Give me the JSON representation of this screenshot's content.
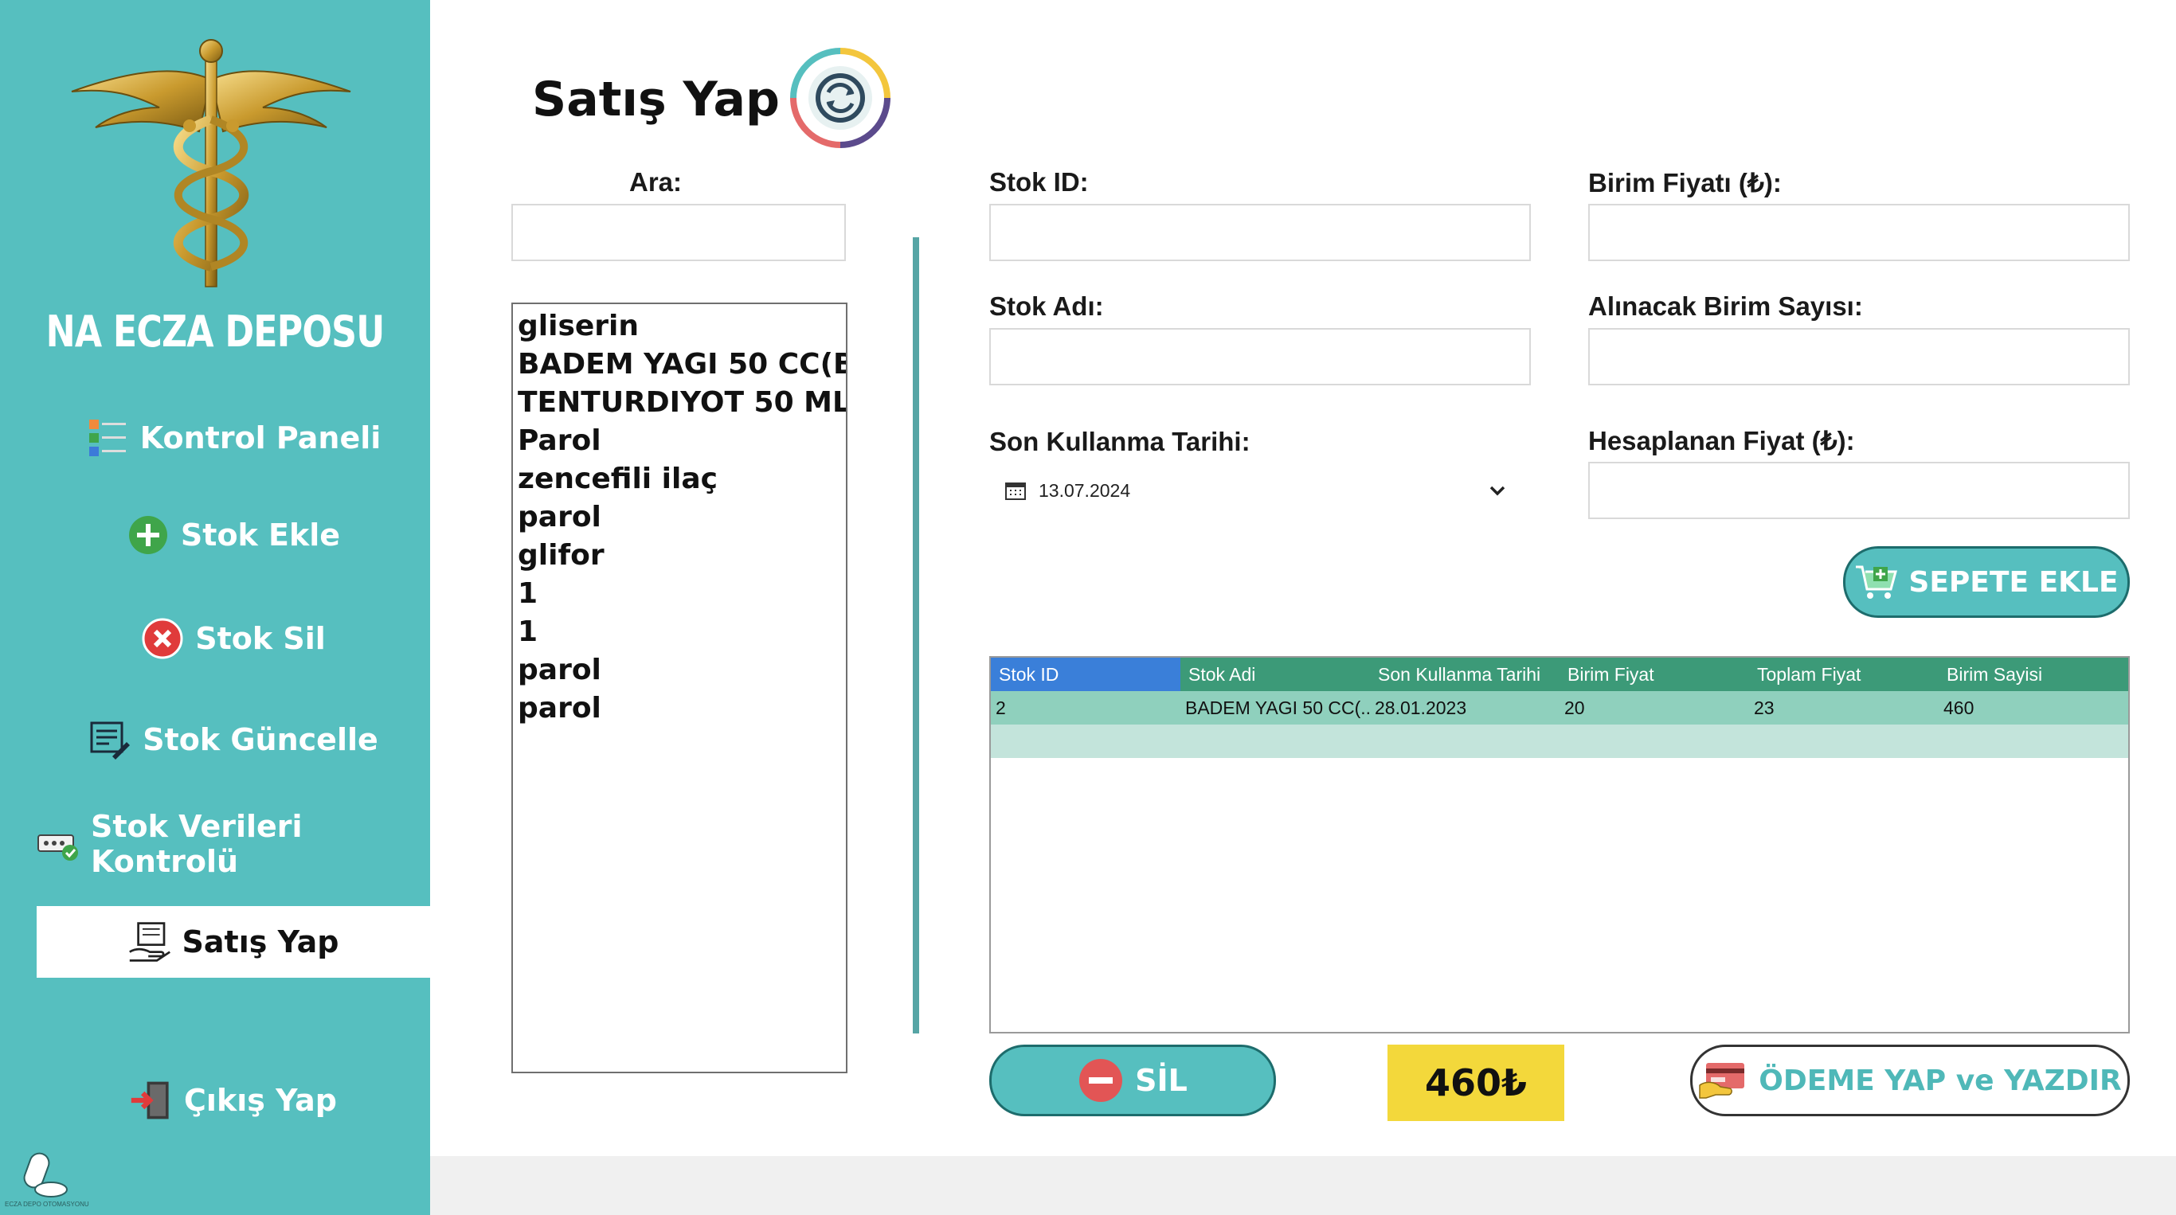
{
  "sidebar": {
    "brand": "NA ECZA DEPOSU",
    "items": [
      {
        "label": "Kontrol Paneli"
      },
      {
        "label": "Stok Ekle"
      },
      {
        "label": "Stok Sil"
      },
      {
        "label": "Stok Güncelle"
      },
      {
        "label": "Stok Verileri Kontrolü"
      },
      {
        "label": "Satış Yap"
      },
      {
        "label": "Çıkış Yap"
      }
    ],
    "active_item": "Satış Yap",
    "footer_text": "ECZA DEPO OTOMASYONU"
  },
  "page": {
    "title": "Satış Yap"
  },
  "search": {
    "label": "Ara:",
    "value": ""
  },
  "product_list": [
    "gliserin",
    "BADEM YAGI 50 CC(B",
    "TENTURDIYOT 50 ML",
    "Parol",
    "zencefili ilaç",
    "parol",
    "glifor",
    "1",
    "1",
    "parol",
    "parol"
  ],
  "form": {
    "stock_id_label": "Stok ID:",
    "stock_id_value": "",
    "unit_price_label": "Birim Fiyatı (₺):",
    "unit_price_value": "",
    "stock_name_label": "Stok Adı:",
    "stock_name_value": "",
    "unit_count_label": "Alınacak Birim Sayısı:",
    "unit_count_value": "",
    "expiry_label": "Son Kullanma Tarihi:",
    "expiry_value": "13.07.2024",
    "calc_price_label": "Hesaplanan Fiyat (₺):",
    "calc_price_value": ""
  },
  "buttons": {
    "add_to_cart": "SEPETE EKLE",
    "delete": "SİL",
    "pay_print": "ÖDEME YAP ve YAZDIR"
  },
  "cart_grid": {
    "columns": [
      "Stok ID",
      "Stok Adi",
      "Son Kullanma Tarihi",
      "Birim Fiyat",
      "Toplam Fiyat",
      "Birim Sayisi"
    ],
    "rows": [
      [
        "2",
        "BADEM YAGI 50 CC(...",
        "28.01.2023",
        "20",
        "23",
        "460"
      ]
    ]
  },
  "total": "460₺",
  "colors": {
    "sidebar": "#56bfbf",
    "grid_header": "#3c9a78",
    "grid_header_selected": "#3a7fd9",
    "grid_row": "#8fd0bd",
    "total_bg": "#f3d83b"
  }
}
